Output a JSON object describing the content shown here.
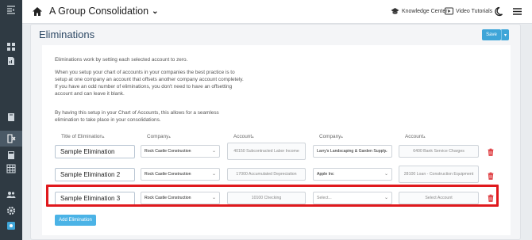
{
  "topbar": {
    "title": "A Group Consolidation",
    "knowledge_center": "Knowledge Center",
    "video_tutorials": "Video Tutorials"
  },
  "page": {
    "title": "Eliminations",
    "save_label": "Save"
  },
  "description": {
    "p1": "Eliminations work by setting each selected account to zero.",
    "p2": "When you setup your chart of accounts in your companies the best practice is to setup at one company an account that offsets another company account completely. If you have an odd number of eliminations, you don't need to have an offsetting account and can leave it blank.",
    "p3": "By having this setup in your Chart of Accounts, this allows for a seamless elimination to take place in your consolidations."
  },
  "columns": [
    "Title of Elimination",
    "Company",
    "Account",
    "Company",
    "Account"
  ],
  "sort_glyph": "▴",
  "rows": [
    {
      "title": "Sample Elimination",
      "company1": "Rock Castle Construction",
      "account1": "40150 Subcontracted Labor Income",
      "company2": "Larry's Landscaping & Garden Supply",
      "account2": "6400 Bank Service Charges"
    },
    {
      "title": "Sample Elimination 2",
      "company1": "Rock Castle Construction",
      "account1": "17000 Accumulated Depreciation",
      "company2": "Apple Inc",
      "account2": "28100 Loan - Construction Equipment"
    },
    {
      "title": "Sample Elimination 3",
      "company1": "Rock Castle Construction",
      "account1": "10100 Checking",
      "company2": "Select...",
      "account2": "Select Account"
    }
  ],
  "add_label": "Add Elimination",
  "colors": {
    "sidebar": "#2f3a43",
    "accent": "#3ea5d8",
    "highlight": "#e0191d",
    "delete": "#e0464a"
  }
}
